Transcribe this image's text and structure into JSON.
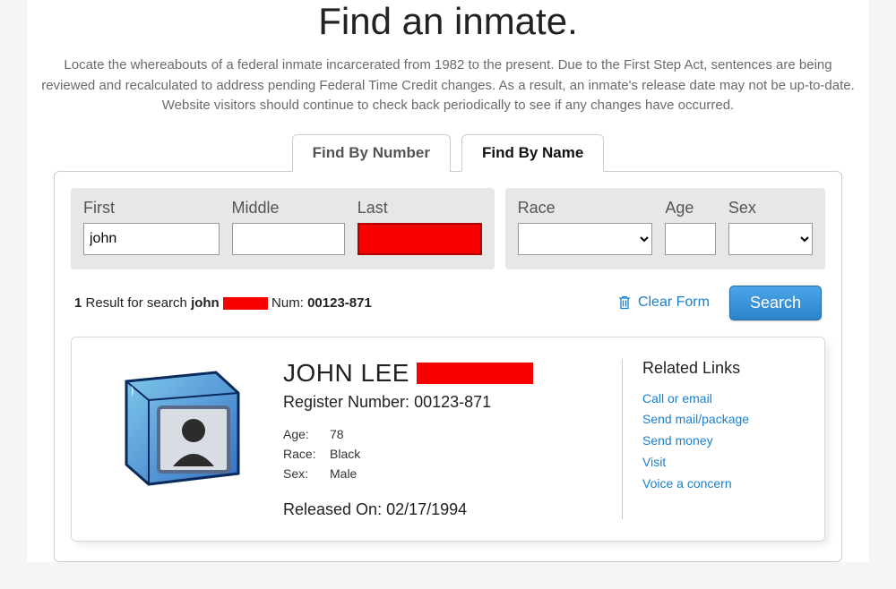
{
  "page": {
    "title": "Find an inmate.",
    "intro": "Locate the whereabouts of a federal inmate incarcerated from 1982 to the present. Due to the First Step Act, sentences are being reviewed and recalculated to address pending Federal Time Credit changes. As a result, an inmate's release date may not be up-to-date. Website visitors should continue to check back periodically to see if any changes have occurred."
  },
  "tabs": {
    "by_number": "Find By Number",
    "by_name": "Find By Name"
  },
  "fields": {
    "first_label": "First",
    "middle_label": "Middle",
    "last_label": "Last",
    "race_label": "Race",
    "age_label": "Age",
    "sex_label": "Sex",
    "first_value": "john"
  },
  "results_bar": {
    "count": "1",
    "prefix": " Result for search ",
    "query_first": "john",
    "num_label": "  Num: ",
    "num": "00123-871",
    "clear_label": "Clear Form",
    "search_label": "Search"
  },
  "result": {
    "name_prefix": "JOHN LEE ",
    "reg_label": "Register Number: ",
    "reg_num": "00123-871",
    "age_label": "Age:",
    "age": "78",
    "race_label": "Race:",
    "race": "Black",
    "sex_label": "Sex:",
    "sex": "Male",
    "released_label": "Released On: ",
    "released": "02/17/1994"
  },
  "related": {
    "title": "Related Links",
    "links": {
      "call": "Call or email",
      "mail": "Send mail/package",
      "money": "Send money",
      "visit": "Visit",
      "concern": "Voice a concern"
    }
  }
}
